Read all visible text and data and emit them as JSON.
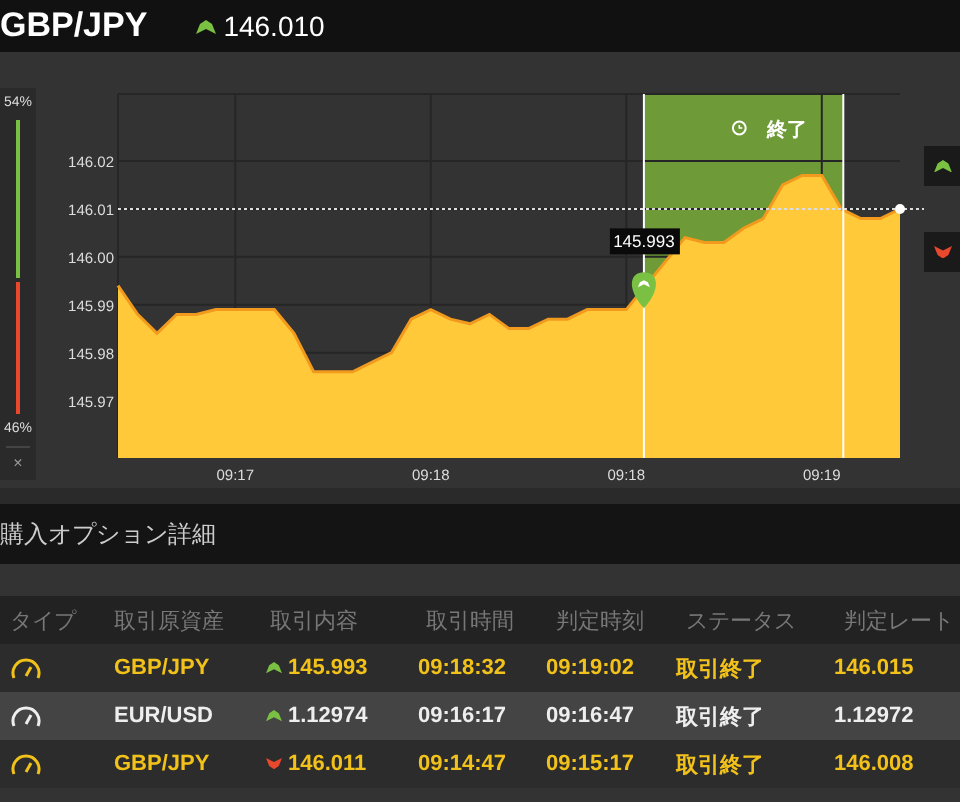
{
  "header": {
    "symbol": "GBP/JPY",
    "kind": "up",
    "price": "146.010"
  },
  "sentiment": {
    "up": {
      "label": "54%",
      "level": 0.54
    },
    "down": {
      "label": "46%"
    },
    "close": "×"
  },
  "chart": {
    "expiry_label": "終了",
    "entry_tag": "145.993",
    "chart_data": {
      "type": "area",
      "categories": [
        null,
        null,
        null,
        null,
        null,
        null,
        "09:17",
        null,
        null,
        null,
        null,
        null,
        null,
        null,
        null,
        null,
        "09:18",
        null,
        null,
        null,
        null,
        null,
        null,
        null,
        null,
        null,
        "09:18",
        null,
        null,
        null,
        null,
        null,
        null,
        null,
        null,
        null,
        "09:19",
        null,
        null,
        null,
        null
      ],
      "series": [
        {
          "color": "#ffc93a",
          "values": [
            145.994,
            145.988,
            145.984,
            145.988,
            145.988,
            145.989,
            145.989,
            145.989,
            145.989,
            145.984,
            145.976,
            145.976,
            145.976,
            145.978,
            145.98,
            145.987,
            145.989,
            145.987,
            145.986,
            145.988,
            145.985,
            145.985,
            145.987,
            145.987,
            145.989,
            145.989,
            145.989,
            null,
            null,
            146.004,
            146.003,
            146.003,
            146.006,
            146.008,
            146.015,
            146.017,
            146.017,
            146.01,
            146.008,
            146.008,
            146.01
          ]
        }
      ],
      "ylim": [
        145.958,
        146.034
      ],
      "grid": true,
      "ref_lines": [
        {
          "axis": "y",
          "value": 146.01
        }
      ],
      "yticks": [
        {
          "value": 145.97,
          "label": "145.97"
        },
        {
          "value": 145.98,
          "label": "145.98"
        },
        {
          "value": 145.99,
          "label": "145.99"
        },
        {
          "value": 146.0,
          "label": "146.00"
        },
        {
          "value": 146.01,
          "label": "146.01"
        },
        {
          "value": 146.02,
          "label": "146.02"
        }
      ]
    }
  },
  "side_buttons": [
    {
      "kind": "up"
    },
    {
      "kind": "down"
    }
  ],
  "details": {
    "title": "購入オプション詳細",
    "columns": [
      "タイプ",
      "取引原資産",
      "取引内容",
      "取引時間",
      "判定時刻",
      "ステータス",
      "判定レート"
    ],
    "rows": [
      {
        "highlighted": true,
        "asset": "GBP/JPY",
        "kind": "up",
        "entry": "145.993",
        "trade_time": "09:18:32",
        "judge_time": "09:19:02",
        "status": "取引終了",
        "rate": "146.015"
      },
      {
        "highlighted": false,
        "asset": "EUR/USD",
        "kind": "up",
        "entry": "1.12974",
        "trade_time": "09:16:17",
        "judge_time": "09:16:47",
        "status": "取引終了",
        "rate": "1.12972"
      },
      {
        "highlighted": true,
        "asset": "GBP/JPY",
        "kind": "down",
        "entry": "146.011",
        "trade_time": "09:14:47",
        "judge_time": "09:15:17",
        "status": "取引終了",
        "rate": "146.008"
      }
    ]
  }
}
